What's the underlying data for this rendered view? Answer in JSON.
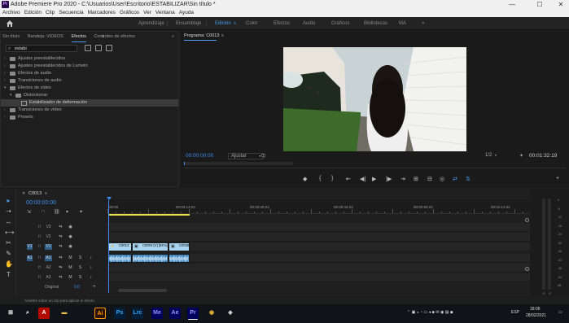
{
  "window": {
    "title": "Adobe Premiere Pro 2020 - C:\\Usuarios\\User\\Escritorio\\ESTABILIZAR\\Sin título *",
    "app_icon_label": "Pr",
    "minimize": "—",
    "maximize": "☐",
    "close": "✕"
  },
  "menu": [
    "Archivo",
    "Edición",
    "Clip",
    "Secuencia",
    "Marcadores",
    "Gráficos",
    "Ver",
    "Ventana",
    "Ayuda"
  ],
  "workspaces": {
    "items": [
      "Aprendizaje",
      "Ensamblaje",
      "Edición",
      "Color",
      "Efectos",
      "Audio",
      "Gráficos",
      "Bibliotecas",
      "MA"
    ],
    "active": "Edición",
    "more": "»"
  },
  "effects_panel": {
    "tabs": [
      "Sin título",
      "Bandeja: VIDEOS",
      "Efectos",
      "Controles de efectos"
    ],
    "active_tab": "Efectos",
    "tab_menu": "≡",
    "more": "»",
    "search_value": "estabi",
    "tree": [
      {
        "label": "Ajustes preestablecidos",
        "depth": 0,
        "kind": "folder",
        "expanded": false
      },
      {
        "label": "Ajustes preestablecidos de Lumetri",
        "depth": 0,
        "kind": "folder",
        "expanded": false
      },
      {
        "label": "Efectos de audio",
        "depth": 0,
        "kind": "folder",
        "expanded": false
      },
      {
        "label": "Transiciones de audio",
        "depth": 0,
        "kind": "folder",
        "expanded": false
      },
      {
        "label": "Efectos de vídeo",
        "depth": 0,
        "kind": "folder",
        "expanded": true
      },
      {
        "label": "Distorsionar",
        "depth": 1,
        "kind": "folder",
        "expanded": true
      },
      {
        "label": "Estabilizador de deformación",
        "depth": 2,
        "kind": "effect",
        "selected": true
      },
      {
        "label": "Transiciones de vídeo",
        "depth": 0,
        "kind": "folder",
        "expanded": false
      },
      {
        "label": "Presets",
        "depth": 0,
        "kind": "folder",
        "expanded": false
      }
    ]
  },
  "program_monitor": {
    "title": "Programa: C0013",
    "menu": "≡",
    "current_timecode": "00:00:00:00",
    "fit": "Ajustar",
    "resolution": "1/2",
    "duration": "00:01:32:19",
    "transport": [
      "◆",
      "{",
      "}",
      "⇤",
      "◀|",
      "▶",
      "|▶",
      "⇥",
      "⊞",
      "⊟",
      "◎",
      "⇄",
      "⇅",
      "+"
    ]
  },
  "tools": [
    "▸",
    "⇢",
    "↔",
    "⟷",
    "✂",
    "✎",
    "✋",
    "T"
  ],
  "timeline": {
    "sequence_name": "C0013",
    "close": "✕",
    "menu": "≡",
    "timecode": "00:00:00:00",
    "ruler_labels": [
      "00:00",
      "00:00:14:23",
      "00:00:29:23",
      "00:00:44:22",
      "00:00:59:22",
      "00:01:14:22"
    ],
    "video_tracks": [
      "V3",
      "V2",
      "V1"
    ],
    "audio_tracks": [
      "A1",
      "A2",
      "A3"
    ],
    "source_video": "V1",
    "source_audio": "A1",
    "mute": "M",
    "solo": "S",
    "master": "Original",
    "master_value": "0,0",
    "clips_video": [
      {
        "name": "C0013",
        "color": "#a9d5f0"
      },
      {
        "name": "C0003 [V] [64%]",
        "color": "#a9d5f0"
      },
      {
        "name": "C0045",
        "color": "#a9d5f0"
      }
    ]
  },
  "meter": {
    "labels": [
      "0",
      "-6",
      "-12",
      "-18",
      "-24",
      "-30",
      "-36",
      "-42",
      "-48",
      "-54",
      "dB"
    ],
    "solo_buttons": [
      "S",
      "S"
    ]
  },
  "status": "Arrastre sobre un clip para aplicar el efecto.",
  "taskbar": {
    "apps": [
      {
        "name": "start",
        "label": "⊞",
        "bg": "#101418",
        "fg": "#ffffff"
      },
      {
        "name": "search",
        "label": "⌕",
        "bg": "#101418",
        "fg": "#ffffff"
      },
      {
        "name": "acrobat",
        "label": "A",
        "bg": "#b30b00",
        "fg": "#ffffff"
      },
      {
        "name": "folder",
        "label": "▬",
        "bg": "#101418",
        "fg": "#f0c14b"
      },
      {
        "name": "illustrator",
        "label": "Ai",
        "bg": "#2b1200",
        "fg": "#ff9a00"
      },
      {
        "name": "photoshop",
        "label": "Ps",
        "bg": "#001e36",
        "fg": "#31a8ff"
      },
      {
        "name": "lightroom",
        "label": "Lrc",
        "bg": "#001e36",
        "fg": "#31a8ff"
      },
      {
        "name": "media-encoder",
        "label": "Me",
        "bg": "#00005b",
        "fg": "#8f8fff"
      },
      {
        "name": "after-effects",
        "label": "Ae",
        "bg": "#00005b",
        "fg": "#9999ff"
      },
      {
        "name": "premiere",
        "label": "Pr",
        "bg": "#00005b",
        "fg": "#9999ff"
      },
      {
        "name": "chrome",
        "label": "◉",
        "bg": "#101418",
        "fg": "#e8b73a"
      },
      {
        "name": "photos",
        "label": "◈",
        "bg": "#101418",
        "fg": "#ddd"
      }
    ],
    "lang": "ESP",
    "time": "18:06",
    "date": "28/02/2021"
  },
  "colors": {
    "accent": "#4a9ef5",
    "timecode": "#3b8df0",
    "work_area": "#e8e14a",
    "video_clip": "#a9d5f0",
    "audio_clip": "#3a7fb8"
  }
}
